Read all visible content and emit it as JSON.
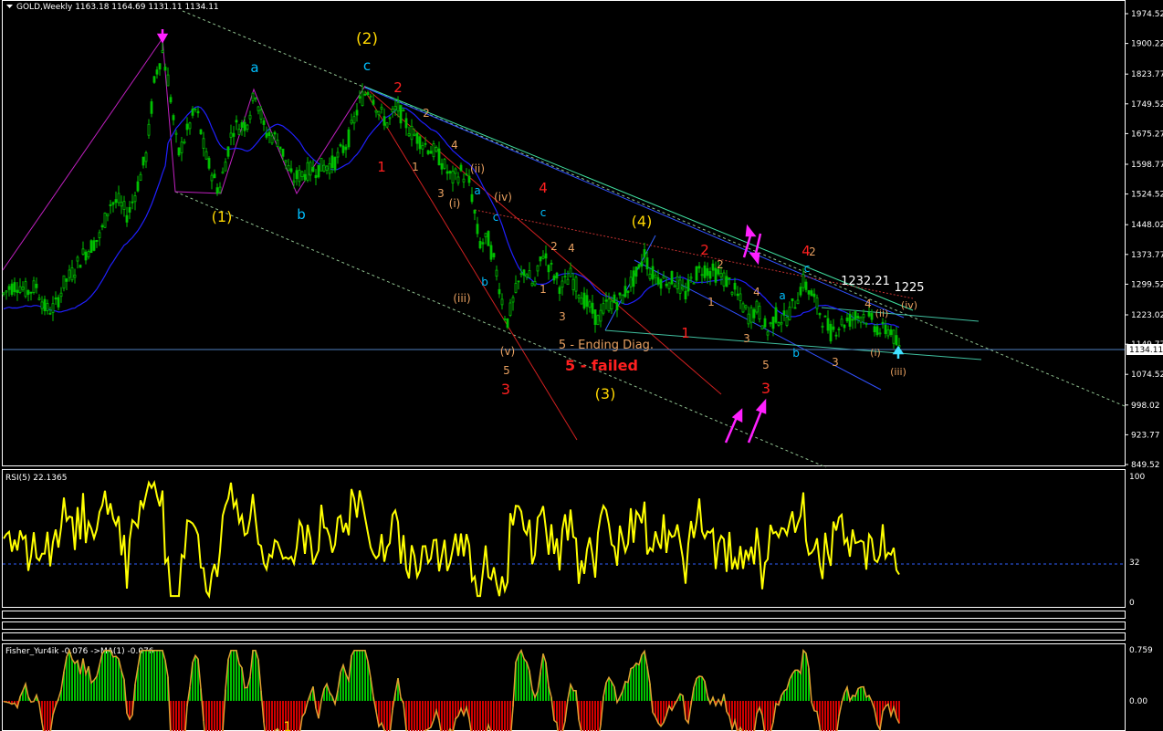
{
  "main_chart": {
    "header": "GOLD,Weekly  1163.18 1164.69 1131.11 1134.11",
    "current_price_label": "1134.11",
    "price_ticks": [
      "1974.52",
      "1900.22",
      "1823.77",
      "1749.52",
      "1675.27",
      "1598.77",
      "1524.52",
      "1448.02",
      "1373.77",
      "1299.52",
      "1223.02",
      "1149.77",
      "1074.52",
      "998.02",
      "923.77",
      "849.52"
    ],
    "price_range": [
      849.52,
      1974.52
    ],
    "annotations": {
      "price_1232": "1232.21",
      "price_1225": "1225",
      "ending_diag": "5 - Ending Diag.",
      "failed": "5 - failed"
    },
    "wave_labels": [
      {
        "t": "(2)",
        "c": "#ffd700",
        "s": 17
      },
      {
        "t": "(1)",
        "c": "#ffd700",
        "s": 16
      },
      {
        "t": "(3)",
        "c": "#ffd700",
        "s": 16
      },
      {
        "t": "(4)",
        "c": "#ffd700",
        "s": 16
      },
      {
        "t": "a",
        "c": "#00bfff",
        "s": 15
      },
      {
        "t": "b",
        "c": "#00bfff",
        "s": 15
      },
      {
        "t": "c",
        "c": "#00bfff",
        "s": 15
      },
      {
        "t": "2",
        "c": "#ff2020",
        "s": 15
      },
      {
        "t": "1",
        "c": "#ff2020",
        "s": 15
      },
      {
        "t": "4",
        "c": "#ff2020",
        "s": 15
      },
      {
        "t": "3",
        "c": "#ff2020",
        "s": 16
      },
      {
        "t": "2",
        "c": "#ff2020",
        "s": 15
      },
      {
        "t": "4",
        "c": "#ff2020",
        "s": 15
      },
      {
        "t": "3",
        "c": "#ff2020",
        "s": 16
      },
      {
        "t": "1",
        "c": "#ff2020",
        "s": 15
      },
      {
        "t": "2",
        "c": "#e8a060",
        "s": 12
      },
      {
        "t": "1",
        "c": "#e8a060",
        "s": 12
      },
      {
        "t": "4",
        "c": "#e8a060",
        "s": 12
      },
      {
        "t": "3",
        "c": "#e8a060",
        "s": 12
      },
      {
        "t": "(ii)",
        "c": "#e8a060",
        "s": 12
      },
      {
        "t": "(i)",
        "c": "#e8a060",
        "s": 12
      },
      {
        "t": "(iv)",
        "c": "#e8a060",
        "s": 12
      },
      {
        "t": "(iii)",
        "c": "#e8a060",
        "s": 12
      },
      {
        "t": "(v)",
        "c": "#e8a060",
        "s": 12
      },
      {
        "t": "5",
        "c": "#e8a060",
        "s": 12
      },
      {
        "t": "a",
        "c": "#00bfff",
        "s": 12
      },
      {
        "t": "c",
        "c": "#00bfff",
        "s": 12
      },
      {
        "t": "b",
        "c": "#00bfff",
        "s": 12
      },
      {
        "t": "c",
        "c": "#00bfff",
        "s": 12
      },
      {
        "t": "2",
        "c": "#e8a060",
        "s": 12
      },
      {
        "t": "4",
        "c": "#e8a060",
        "s": 12
      },
      {
        "t": "1",
        "c": "#e8a060",
        "s": 12
      },
      {
        "t": "3",
        "c": "#e8a060",
        "s": 12
      },
      {
        "t": "2",
        "c": "#e8a060",
        "s": 12
      },
      {
        "t": "1",
        "c": "#e8a060",
        "s": 12
      },
      {
        "t": "4",
        "c": "#e8a060",
        "s": 12
      },
      {
        "t": "3",
        "c": "#e8a060",
        "s": 12
      },
      {
        "t": "5",
        "c": "#e8a060",
        "s": 12
      },
      {
        "t": "a",
        "c": "#00bfff",
        "s": 12
      },
      {
        "t": "b",
        "c": "#00bfff",
        "s": 12
      },
      {
        "t": "c",
        "c": "#00bfff",
        "s": 12
      },
      {
        "t": "2",
        "c": "#e8a060",
        "s": 12
      },
      {
        "t": "3",
        "c": "#e8a060",
        "s": 12
      },
      {
        "t": "4",
        "c": "#e8a060",
        "s": 12
      },
      {
        "t": "(ii)",
        "c": "#e8a060",
        "s": 11
      },
      {
        "t": "(iv)",
        "c": "#e8a060",
        "s": 11
      },
      {
        "t": "(i)",
        "c": "#e8a060",
        "s": 11
      },
      {
        "t": "(iii)",
        "c": "#e8a060",
        "s": 11
      }
    ]
  },
  "rsi": {
    "header": "RSI(5) 22.1365",
    "ticks": [
      "100",
      "32",
      "0"
    ],
    "level": 32
  },
  "fisher": {
    "header": "Fisher_Yur4ik -0.076  ->MA(1) -0.076",
    "ticks": [
      "0.759",
      "0.00"
    ],
    "marker": "1"
  },
  "colors": {
    "background": "#000000",
    "bull_candle": "#00c000",
    "bear_candle": "#00c000",
    "ma_line": "#2020ff",
    "rsi_line": "#ffff00",
    "fisher_up": "#00c000",
    "fisher_down": "#d00000",
    "grid_line": "#ffffff"
  },
  "chart_data": {
    "type": "line",
    "title": "GOLD,Weekly",
    "series": [
      {
        "name": "GOLD",
        "points": [
          [
            0,
            1265
          ],
          [
            10,
            1290
          ],
          [
            20,
            1300
          ],
          [
            30,
            1280
          ],
          [
            40,
            1295
          ],
          [
            50,
            1235
          ],
          [
            60,
            1240
          ],
          [
            70,
            1300
          ],
          [
            80,
            1330
          ],
          [
            90,
            1370
          ],
          [
            100,
            1395
          ],
          [
            110,
            1420
          ],
          [
            120,
            1500
          ],
          [
            130,
            1505
          ],
          [
            140,
            1470
          ],
          [
            150,
            1540
          ],
          [
            160,
            1620
          ],
          [
            170,
            1820
          ],
          [
            178,
            1880
          ],
          [
            185,
            1800
          ],
          [
            195,
            1620
          ],
          [
            205,
            1680
          ],
          [
            215,
            1740
          ],
          [
            225,
            1620
          ],
          [
            240,
            1530
          ],
          [
            255,
            1690
          ],
          [
            270,
            1700
          ],
          [
            280,
            1780
          ],
          [
            290,
            1680
          ],
          [
            305,
            1660
          ],
          [
            320,
            1560
          ],
          [
            335,
            1580
          ],
          [
            350,
            1590
          ],
          [
            365,
            1600
          ],
          [
            380,
            1650
          ],
          [
            395,
            1760
          ],
          [
            405,
            1790
          ],
          [
            415,
            1730
          ],
          [
            425,
            1700
          ],
          [
            435,
            1740
          ],
          [
            450,
            1680
          ],
          [
            465,
            1650
          ],
          [
            480,
            1620
          ],
          [
            495,
            1560
          ],
          [
            505,
            1580
          ],
          [
            515,
            1550
          ],
          [
            525,
            1400
          ],
          [
            535,
            1410
          ],
          [
            545,
            1320
          ],
          [
            555,
            1200
          ],
          [
            565,
            1280
          ],
          [
            575,
            1340
          ],
          [
            585,
            1290
          ],
          [
            595,
            1380
          ],
          [
            605,
            1330
          ],
          [
            615,
            1290
          ],
          [
            625,
            1320
          ],
          [
            640,
            1260
          ],
          [
            655,
            1210
          ],
          [
            665,
            1250
          ],
          [
            680,
            1260
          ],
          [
            690,
            1300
          ],
          [
            700,
            1330
          ],
          [
            706,
            1380
          ],
          [
            712,
            1330
          ],
          [
            725,
            1310
          ],
          [
            740,
            1310
          ],
          [
            750,
            1270
          ],
          [
            760,
            1320
          ],
          [
            770,
            1340
          ],
          [
            780,
            1330
          ],
          [
            790,
            1320
          ],
          [
            800,
            1300
          ],
          [
            810,
            1260
          ],
          [
            820,
            1220
          ],
          [
            830,
            1240
          ],
          [
            840,
            1180
          ],
          [
            850,
            1220
          ],
          [
            860,
            1210
          ],
          [
            870,
            1250
          ],
          [
            880,
            1305
          ],
          [
            890,
            1270
          ],
          [
            900,
            1220
          ],
          [
            910,
            1180
          ],
          [
            920,
            1200
          ],
          [
            930,
            1210
          ],
          [
            945,
            1225
          ],
          [
            955,
            1205
          ],
          [
            965,
            1180
          ],
          [
            975,
            1190
          ],
          [
            985,
            1134
          ]
        ]
      }
    ],
    "ylim": [
      849.52,
      1974.52
    ],
    "yticks": [
      1974.52,
      1900.22,
      1823.77,
      1749.52,
      1675.27,
      1598.77,
      1524.52,
      1448.02,
      1373.77,
      1299.52,
      1223.02,
      1149.77,
      1074.52,
      998.02,
      923.77,
      849.52
    ],
    "last_price": 1134.11,
    "grid": false
  }
}
